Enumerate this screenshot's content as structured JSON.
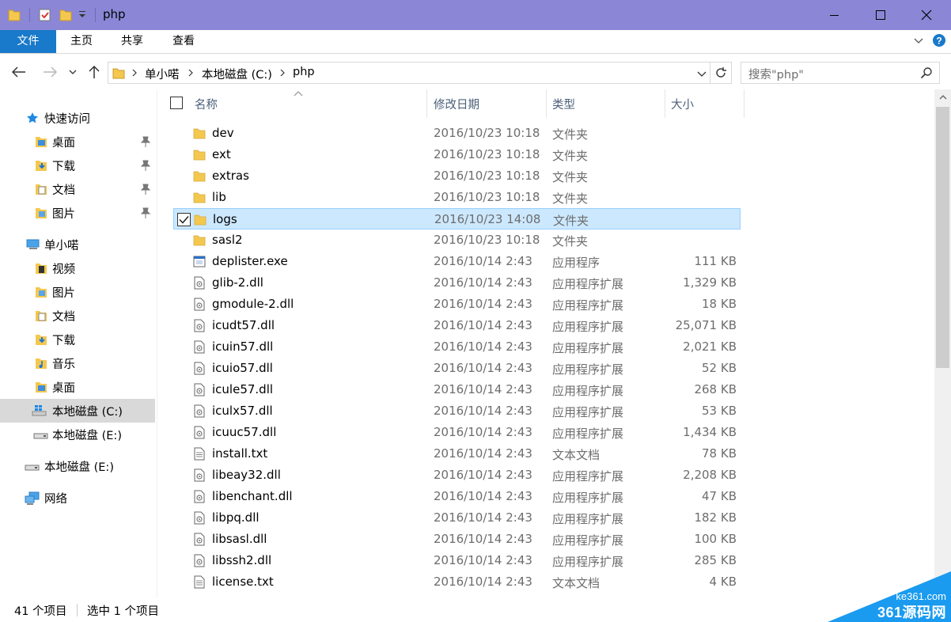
{
  "window": {
    "title": "php",
    "minimize": "—",
    "maximize": "☐",
    "close": "✕"
  },
  "ribbon": {
    "tabs": [
      {
        "label": "文件"
      },
      {
        "label": "主页"
      },
      {
        "label": "共享"
      },
      {
        "label": "查看"
      }
    ]
  },
  "address": {
    "path": [
      "单小喏",
      "本地磁盘 (C:)",
      "php"
    ]
  },
  "search": {
    "placeholder": "搜索\"php\""
  },
  "sidebar": {
    "quick_access": "快速访问",
    "quick_items": [
      {
        "label": "桌面"
      },
      {
        "label": "下载"
      },
      {
        "label": "文档"
      },
      {
        "label": "图片"
      }
    ],
    "pc": "单小喏",
    "pc_items": [
      {
        "label": "视频"
      },
      {
        "label": "图片"
      },
      {
        "label": "文档"
      },
      {
        "label": "下载"
      },
      {
        "label": "音乐"
      },
      {
        "label": "桌面"
      },
      {
        "label": "本地磁盘 (C:)"
      },
      {
        "label": "本地磁盘 (E:)"
      }
    ],
    "drive_e": "本地磁盘 (E:)",
    "network": "网络"
  },
  "columns": {
    "name": "名称",
    "date": "修改日期",
    "type": "类型",
    "size": "大小"
  },
  "files": [
    {
      "name": "dev",
      "date": "2016/10/23 10:18",
      "type": "文件夹",
      "size": "",
      "kind": "folder"
    },
    {
      "name": "ext",
      "date": "2016/10/23 10:18",
      "type": "文件夹",
      "size": "",
      "kind": "folder"
    },
    {
      "name": "extras",
      "date": "2016/10/23 10:18",
      "type": "文件夹",
      "size": "",
      "kind": "folder"
    },
    {
      "name": "lib",
      "date": "2016/10/23 10:18",
      "type": "文件夹",
      "size": "",
      "kind": "folder"
    },
    {
      "name": "logs",
      "date": "2016/10/23 14:08",
      "type": "文件夹",
      "size": "",
      "kind": "folder",
      "selected": true
    },
    {
      "name": "sasl2",
      "date": "2016/10/23 10:18",
      "type": "文件夹",
      "size": "",
      "kind": "folder"
    },
    {
      "name": "deplister.exe",
      "date": "2016/10/14 2:43",
      "type": "应用程序",
      "size": "111 KB",
      "kind": "exe"
    },
    {
      "name": "glib-2.dll",
      "date": "2016/10/14 2:43",
      "type": "应用程序扩展",
      "size": "1,329 KB",
      "kind": "dll"
    },
    {
      "name": "gmodule-2.dll",
      "date": "2016/10/14 2:43",
      "type": "应用程序扩展",
      "size": "18 KB",
      "kind": "dll"
    },
    {
      "name": "icudt57.dll",
      "date": "2016/10/14 2:43",
      "type": "应用程序扩展",
      "size": "25,071 KB",
      "kind": "dll"
    },
    {
      "name": "icuin57.dll",
      "date": "2016/10/14 2:43",
      "type": "应用程序扩展",
      "size": "2,021 KB",
      "kind": "dll"
    },
    {
      "name": "icuio57.dll",
      "date": "2016/10/14 2:43",
      "type": "应用程序扩展",
      "size": "52 KB",
      "kind": "dll"
    },
    {
      "name": "icule57.dll",
      "date": "2016/10/14 2:43",
      "type": "应用程序扩展",
      "size": "268 KB",
      "kind": "dll"
    },
    {
      "name": "iculx57.dll",
      "date": "2016/10/14 2:43",
      "type": "应用程序扩展",
      "size": "53 KB",
      "kind": "dll"
    },
    {
      "name": "icuuc57.dll",
      "date": "2016/10/14 2:43",
      "type": "应用程序扩展",
      "size": "1,434 KB",
      "kind": "dll"
    },
    {
      "name": "install.txt",
      "date": "2016/10/14 2:43",
      "type": "文本文档",
      "size": "78 KB",
      "kind": "txt"
    },
    {
      "name": "libeay32.dll",
      "date": "2016/10/14 2:43",
      "type": "应用程序扩展",
      "size": "2,208 KB",
      "kind": "dll"
    },
    {
      "name": "libenchant.dll",
      "date": "2016/10/14 2:43",
      "type": "应用程序扩展",
      "size": "47 KB",
      "kind": "dll"
    },
    {
      "name": "libpq.dll",
      "date": "2016/10/14 2:43",
      "type": "应用程序扩展",
      "size": "182 KB",
      "kind": "dll"
    },
    {
      "name": "libsasl.dll",
      "date": "2016/10/14 2:43",
      "type": "应用程序扩展",
      "size": "100 KB",
      "kind": "dll"
    },
    {
      "name": "libssh2.dll",
      "date": "2016/10/14 2:43",
      "type": "应用程序扩展",
      "size": "285 KB",
      "kind": "dll"
    },
    {
      "name": "license.txt",
      "date": "2016/10/14 2:43",
      "type": "文本文档",
      "size": "4 KB",
      "kind": "txt"
    }
  ],
  "status": {
    "count": "41 个项目",
    "selected": "选中 1 个项目"
  },
  "watermark": {
    "domain": "ke361.com",
    "brand": "361源码网"
  },
  "colors": {
    "titlebar": "#8b87d6",
    "file_tab": "#1979ca",
    "selection": "#cce8ff",
    "folder": "#f4c84f"
  }
}
